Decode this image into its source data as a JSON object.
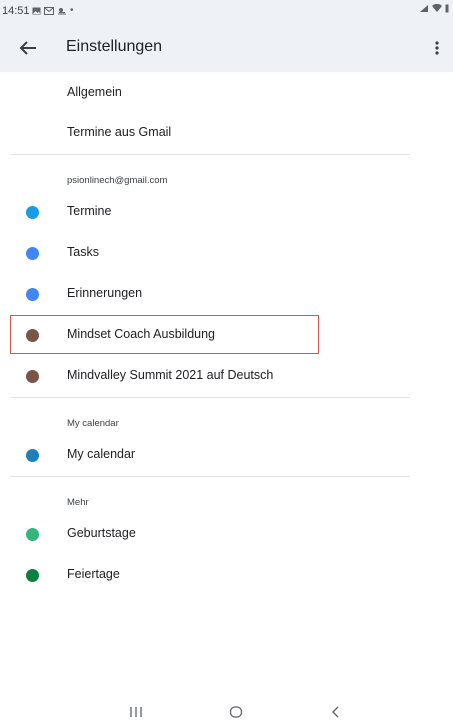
{
  "status_bar": {
    "time": "14:51",
    "left_icons": [
      "gallery-icon",
      "mail-icon",
      "weather-icon",
      "notification-dot-icon"
    ],
    "right_icons": [
      "signal-icon",
      "wifi-icon",
      "battery-icon"
    ]
  },
  "app_bar": {
    "title": "Einstellungen",
    "back_icon": "arrow-back-icon",
    "menu_icon": "more-vert-icon"
  },
  "general_items": [
    {
      "label": "Allgemein"
    },
    {
      "label": "Termine aus Gmail"
    }
  ],
  "sections": [
    {
      "header": "psionlinech@gmail.com",
      "items": [
        {
          "label": "Termine",
          "color": "#1a9be6"
        },
        {
          "label": "Tasks",
          "color": "#4285f4"
        },
        {
          "label": "Erinnerungen",
          "color": "#4285f4"
        },
        {
          "label": "Mindset Coach Ausbildung",
          "color": "#795548",
          "highlighted": true
        },
        {
          "label": "Mindvalley Summit 2021 auf Deutsch",
          "color": "#795548"
        }
      ]
    },
    {
      "header": "My calendar",
      "items": [
        {
          "label": "My calendar",
          "color": "#1f7fb8"
        }
      ]
    },
    {
      "header": "Mehr",
      "items": [
        {
          "label": "Geburtstage",
          "color": "#33b679"
        },
        {
          "label": "Feiertage",
          "color": "#0b8043"
        }
      ]
    }
  ],
  "nav_bar": {
    "recents_icon": "recent-apps-icon",
    "home_icon": "home-icon",
    "back_icon": "nav-back-icon"
  }
}
